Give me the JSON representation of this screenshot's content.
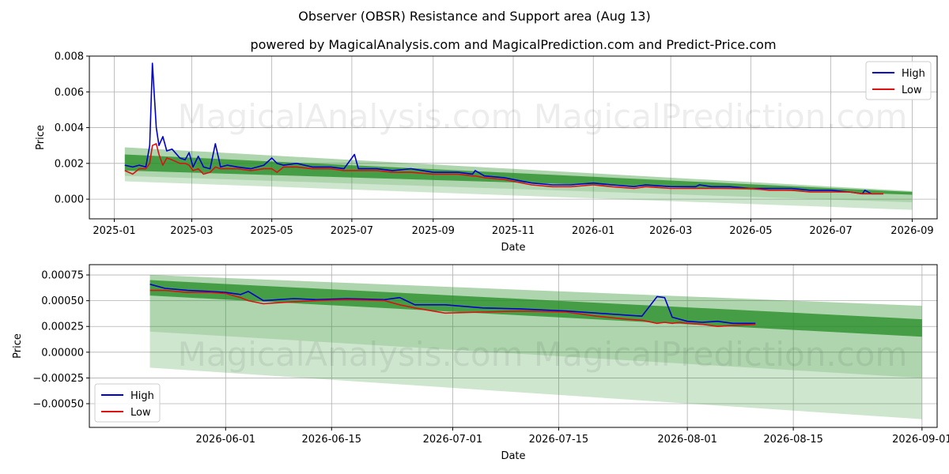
{
  "title": "Observer (OBSR) Resistance and Support area (Aug 13)",
  "subtitle": "powered by MagicalAnalysis.com and MagicalPrediction.com and Predict-Price.com",
  "watermark": "MagicalAnalysis.com    MagicalPrediction.com",
  "colors": {
    "high": "#0000cc",
    "low": "#dd1111",
    "band": "#228b22",
    "grid": "#b0b0b0"
  },
  "chart_data": [
    {
      "type": "line",
      "xlabel": "Date",
      "ylabel": "Price",
      "xlim": [
        "2024-12-13",
        "2026-09-20"
      ],
      "ylim": [
        -0.0011,
        0.008
      ],
      "xticks": [
        "2025-01",
        "2025-03",
        "2025-05",
        "2025-07",
        "2025-09",
        "2025-11",
        "2026-01",
        "2026-03",
        "2026-05",
        "2026-07",
        "2026-09"
      ],
      "yticks": [
        "0.000",
        "0.002",
        "0.004",
        "0.006",
        "0.008"
      ],
      "ytick_values": [
        0,
        0.002,
        0.004,
        0.006,
        0.008
      ],
      "legend": [
        "High",
        "Low"
      ],
      "legend_position": "top-right",
      "grid": true,
      "band": {
        "start": "2025-01-09",
        "end": "2026-09-01",
        "upper": [
          0.0029,
          0.00045
        ],
        "core_upper": [
          0.0025,
          0.0004
        ],
        "core_lower": [
          0.0016,
          0.00025
        ],
        "lower": [
          0.001,
          -0.0006
        ]
      },
      "series": [
        {
          "name": "High",
          "x": [
            "2025-01-09",
            "2025-01-15",
            "2025-01-20",
            "2025-01-25",
            "2025-01-28",
            "2025-01-30",
            "2025-02-02",
            "2025-02-04",
            "2025-02-07",
            "2025-02-10",
            "2025-02-14",
            "2025-02-20",
            "2025-02-24",
            "2025-02-27",
            "2025-03-02",
            "2025-03-06",
            "2025-03-10",
            "2025-03-15",
            "2025-03-19",
            "2025-03-23",
            "2025-03-28",
            "2025-04-05",
            "2025-04-15",
            "2025-04-25",
            "2025-05-01",
            "2025-05-05",
            "2025-05-10",
            "2025-05-20",
            "2025-06-01",
            "2025-06-15",
            "2025-06-25",
            "2025-07-03",
            "2025-07-06",
            "2025-07-10",
            "2025-07-20",
            "2025-08-01",
            "2025-08-15",
            "2025-09-01",
            "2025-09-20",
            "2025-10-01",
            "2025-10-03",
            "2025-10-10",
            "2025-10-25",
            "2025-11-01",
            "2025-11-15",
            "2025-12-01",
            "2025-12-15",
            "2026-01-01",
            "2026-01-15",
            "2026-02-01",
            "2026-02-10",
            "2026-03-01",
            "2026-03-20",
            "2026-03-23",
            "2026-04-01",
            "2026-04-15",
            "2026-05-01",
            "2026-05-15",
            "2026-06-01",
            "2026-06-15",
            "2026-07-01",
            "2026-07-15",
            "2026-07-25",
            "2026-07-27",
            "2026-08-01",
            "2026-08-10"
          ],
          "values": [
            0.0019,
            0.0018,
            0.0019,
            0.0018,
            0.003,
            0.0076,
            0.004,
            0.003,
            0.0035,
            0.0027,
            0.0028,
            0.0023,
            0.0022,
            0.0026,
            0.0018,
            0.0024,
            0.0018,
            0.0017,
            0.0031,
            0.0018,
            0.0019,
            0.0018,
            0.0017,
            0.0019,
            0.0023,
            0.002,
            0.0019,
            0.002,
            0.0018,
            0.0018,
            0.0017,
            0.0025,
            0.0017,
            0.0017,
            0.0017,
            0.0016,
            0.0017,
            0.0015,
            0.0015,
            0.0014,
            0.0016,
            0.0013,
            0.0012,
            0.0011,
            0.0009,
            0.0008,
            0.0008,
            0.0009,
            0.0008,
            0.0007,
            0.0008,
            0.0007,
            0.0007,
            0.0008,
            0.0007,
            0.0007,
            0.0006,
            0.0006,
            0.0006,
            0.0005,
            0.0005,
            0.0004,
            0.0003,
            0.0005,
            0.0003,
            0.0003
          ]
        },
        {
          "name": "Low",
          "x": [
            "2025-01-09",
            "2025-01-15",
            "2025-01-20",
            "2025-01-25",
            "2025-01-28",
            "2025-01-30",
            "2025-02-02",
            "2025-02-04",
            "2025-02-07",
            "2025-02-10",
            "2025-02-14",
            "2025-02-20",
            "2025-02-24",
            "2025-02-27",
            "2025-03-02",
            "2025-03-06",
            "2025-03-10",
            "2025-03-15",
            "2025-03-19",
            "2025-03-23",
            "2025-03-28",
            "2025-04-05",
            "2025-04-15",
            "2025-04-25",
            "2025-05-01",
            "2025-05-05",
            "2025-05-10",
            "2025-05-20",
            "2025-06-01",
            "2025-06-15",
            "2025-06-25",
            "2025-07-03",
            "2025-07-06",
            "2025-07-10",
            "2025-07-20",
            "2025-08-01",
            "2025-08-15",
            "2025-09-01",
            "2025-09-20",
            "2025-10-01",
            "2025-10-03",
            "2025-10-10",
            "2025-10-25",
            "2025-11-01",
            "2025-11-15",
            "2025-12-01",
            "2025-12-15",
            "2026-01-01",
            "2026-01-15",
            "2026-02-01",
            "2026-02-10",
            "2026-03-01",
            "2026-03-20",
            "2026-03-23",
            "2026-04-01",
            "2026-04-15",
            "2026-05-01",
            "2026-05-15",
            "2026-06-01",
            "2026-06-15",
            "2026-07-01",
            "2026-07-15",
            "2026-07-25",
            "2026-07-27",
            "2026-08-01",
            "2026-08-10"
          ],
          "values": [
            0.0016,
            0.0014,
            0.0017,
            0.0017,
            0.002,
            0.003,
            0.0031,
            0.0025,
            0.0019,
            0.0023,
            0.0022,
            0.002,
            0.002,
            0.0019,
            0.0016,
            0.0017,
            0.0014,
            0.0015,
            0.0018,
            0.0017,
            0.0017,
            0.0017,
            0.0016,
            0.0017,
            0.0017,
            0.0015,
            0.0018,
            0.0018,
            0.0017,
            0.0017,
            0.0016,
            0.0016,
            0.0016,
            0.0016,
            0.0016,
            0.0015,
            0.0015,
            0.0014,
            0.0014,
            0.0013,
            0.0013,
            0.0012,
            0.0011,
            0.001,
            0.0008,
            0.0007,
            0.0007,
            0.0008,
            0.0007,
            0.0006,
            0.0007,
            0.0006,
            0.0006,
            0.0006,
            0.0006,
            0.0006,
            0.0006,
            0.0005,
            0.0005,
            0.0004,
            0.0004,
            0.0004,
            0.0003,
            0.0003,
            0.0003,
            0.0003
          ]
        }
      ]
    },
    {
      "type": "line",
      "xlabel": "Date",
      "ylabel": "Price",
      "xlim": [
        "2026-05-14",
        "2026-09-03"
      ],
      "ylim": [
        -0.00073,
        0.00085
      ],
      "xticks": [
        "2026-06-01",
        "2026-06-15",
        "2026-07-01",
        "2026-07-15",
        "2026-08-01",
        "2026-08-15",
        "2026-09-01"
      ],
      "yticks": [
        "−0.00050",
        "−0.00025",
        "0.00000",
        "0.00025",
        "0.00050",
        "0.00075"
      ],
      "ytick_values": [
        -0.0005,
        -0.00025,
        0,
        0.00025,
        0.0005,
        0.00075
      ],
      "legend": [
        "High",
        "Low"
      ],
      "legend_position": "bottom-left",
      "grid": true,
      "band": {
        "start": "2026-05-22",
        "end": "2026-09-01",
        "upper": [
          0.00075,
          0.00045
        ],
        "core_upper": [
          0.0007,
          0.00032
        ],
        "core_lower": [
          0.00055,
          0.00015
        ],
        "lower": [
          -0.00015,
          -0.00065
        ]
      },
      "series": [
        {
          "name": "High",
          "x": [
            "2026-05-22",
            "2026-05-24",
            "2026-05-27",
            "2026-05-30",
            "2026-06-01",
            "2026-06-03",
            "2026-06-04",
            "2026-06-06",
            "2026-06-10",
            "2026-06-13",
            "2026-06-17",
            "2026-06-22",
            "2026-06-24",
            "2026-06-26",
            "2026-06-30",
            "2026-07-05",
            "2026-07-10",
            "2026-07-16",
            "2026-07-20",
            "2026-07-24",
            "2026-07-26",
            "2026-07-28",
            "2026-07-29",
            "2026-07-30",
            "2026-07-31",
            "2026-08-01",
            "2026-08-03",
            "2026-08-05",
            "2026-08-07",
            "2026-08-10"
          ],
          "values": [
            0.00066,
            0.00062,
            0.0006,
            0.00059,
            0.00058,
            0.00056,
            0.00059,
            0.0005,
            0.00052,
            0.00051,
            0.00052,
            0.00051,
            0.00053,
            0.00046,
            0.00046,
            0.00043,
            0.00042,
            0.0004,
            0.00038,
            0.00036,
            0.00035,
            0.00054,
            0.00053,
            0.00034,
            0.00032,
            0.0003,
            0.00029,
            0.0003,
            0.00028,
            0.00028
          ]
        },
        {
          "name": "Low",
          "x": [
            "2026-05-22",
            "2026-05-24",
            "2026-05-27",
            "2026-05-30",
            "2026-06-01",
            "2026-06-03",
            "2026-06-04",
            "2026-06-06",
            "2026-06-10",
            "2026-06-13",
            "2026-06-17",
            "2026-06-22",
            "2026-06-24",
            "2026-06-26",
            "2026-06-30",
            "2026-07-05",
            "2026-07-10",
            "2026-07-16",
            "2026-07-20",
            "2026-07-24",
            "2026-07-26",
            "2026-07-28",
            "2026-07-29",
            "2026-07-30",
            "2026-07-31",
            "2026-08-01",
            "2026-08-03",
            "2026-08-05",
            "2026-08-07",
            "2026-08-10"
          ],
          "values": [
            0.0006,
            0.0006,
            0.00058,
            0.00058,
            0.00057,
            0.00053,
            0.0005,
            0.00047,
            0.00049,
            0.0005,
            0.00051,
            0.0005,
            0.00046,
            0.00043,
            0.00038,
            0.00039,
            0.0004,
            0.00039,
            0.00035,
            0.00032,
            0.00031,
            0.00028,
            0.00029,
            0.00028,
            0.00029,
            0.00028,
            0.00027,
            0.00025,
            0.00026,
            0.00027
          ]
        }
      ]
    }
  ]
}
